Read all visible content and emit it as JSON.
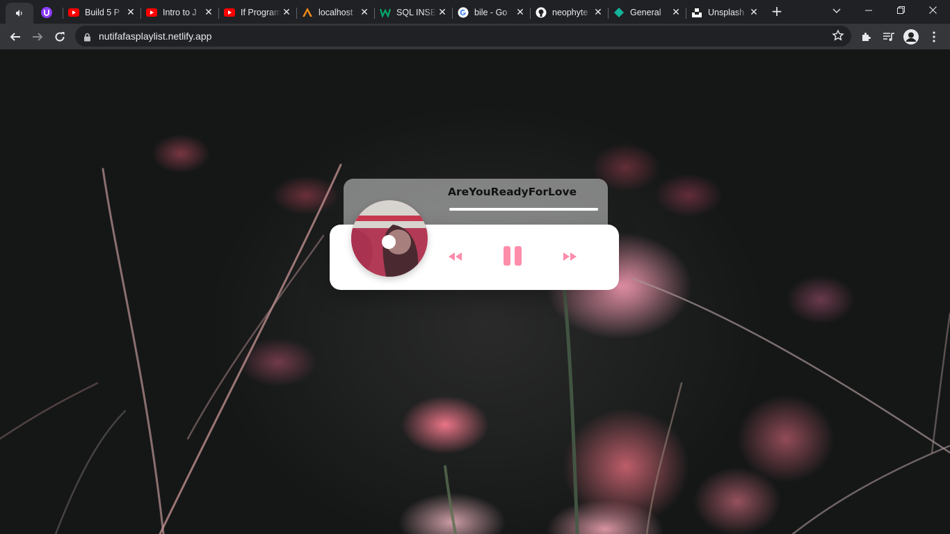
{
  "browser": {
    "tabs": [
      {
        "title": "Build 5 P",
        "icon": "youtube-icon"
      },
      {
        "title": "Intro to J",
        "icon": "youtube-icon"
      },
      {
        "title": "If Program",
        "icon": "youtube-icon"
      },
      {
        "title": "localhost",
        "icon": "xampp-icon"
      },
      {
        "title": "SQL INSE",
        "icon": "w3schools-icon"
      },
      {
        "title": "bile - Go",
        "icon": "google-icon"
      },
      {
        "title": "neophyte",
        "icon": "github-icon"
      },
      {
        "title": "General",
        "icon": "diamond-icon"
      },
      {
        "title": "Unsplash",
        "icon": "unsplash-icon"
      }
    ],
    "close_glyph": "✕",
    "new_tab_glyph": "+",
    "url": "nutifafasplaylist.netlify.app",
    "accent": "#35363a"
  },
  "player": {
    "song_title": "AreYouReadyForLove",
    "progress": 0,
    "accent_color": "#fe8daa",
    "controls": [
      "prev-icon",
      "pause-icon",
      "next-icon"
    ]
  }
}
